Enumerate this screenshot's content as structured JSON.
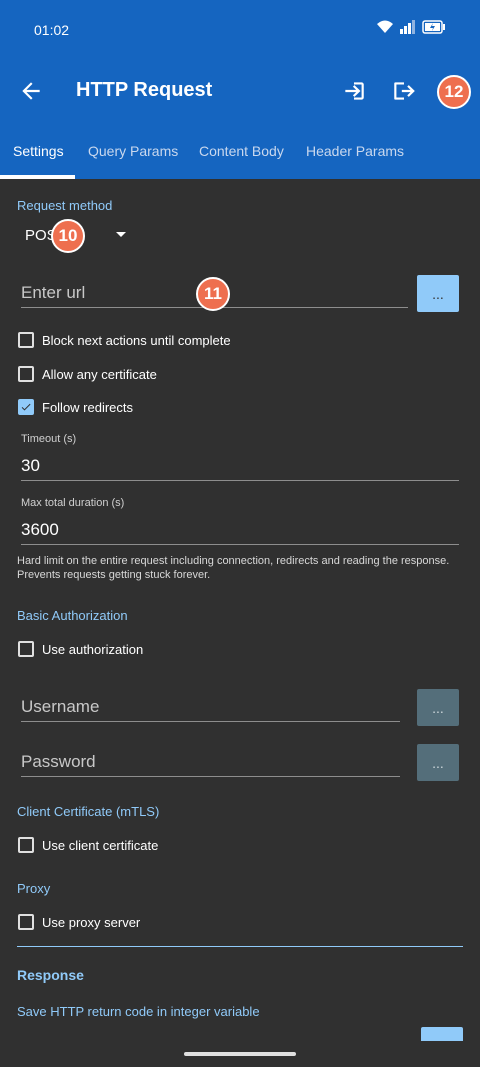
{
  "status": {
    "time": "01:02"
  },
  "appbar": {
    "title": "HTTP Request"
  },
  "badges": {
    "b10": "10",
    "b11": "11",
    "b12": "12"
  },
  "tabs": [
    {
      "label": "Settings"
    },
    {
      "label": "Query Params"
    },
    {
      "label": "Content Body"
    },
    {
      "label": "Header Params"
    }
  ],
  "request": {
    "method_label": "Request method",
    "method_value": "POS",
    "url_placeholder": "Enter url",
    "url_button": "..."
  },
  "options": {
    "block": {
      "label": "Block next actions until complete",
      "checked": false
    },
    "allow_cert": {
      "label": "Allow any certificate",
      "checked": false
    },
    "follow": {
      "label": "Follow redirects",
      "checked": true
    }
  },
  "timeout": {
    "label": "Timeout (s)",
    "value": "30"
  },
  "max_duration": {
    "label": "Max total duration (s)",
    "value": "3600"
  },
  "help_text": "Hard limit on the entire request including connection, redirects and reading the response. Prevents requests getting stuck forever.",
  "auth": {
    "section": "Basic Authorization",
    "use_label": "Use authorization",
    "username_placeholder": "Username",
    "password_placeholder": "Password",
    "dots": "..."
  },
  "client_cert": {
    "section": "Client Certificate (mTLS)",
    "use_label": "Use client certificate"
  },
  "proxy": {
    "section": "Proxy",
    "use_label": "Use proxy server"
  },
  "response": {
    "title": "Response",
    "save_code": "Save HTTP return code in integer variable"
  },
  "colors": {
    "header": "#1565c0",
    "background": "#303030",
    "accent": "#90caf9",
    "badge": "#ee6f4f"
  }
}
